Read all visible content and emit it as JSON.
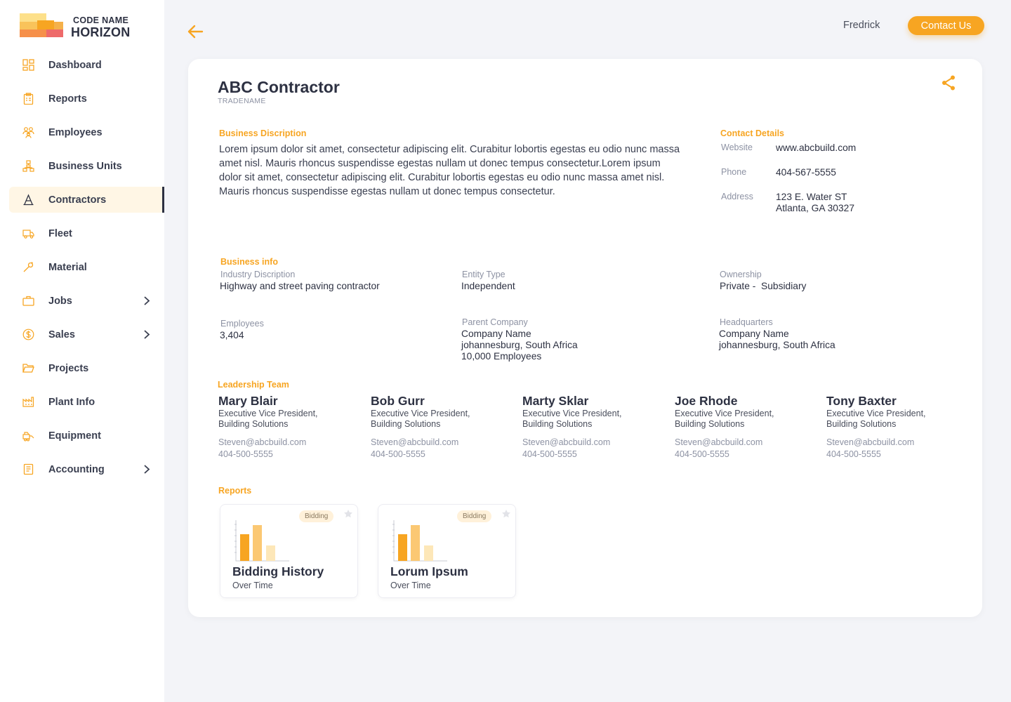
{
  "brand": {
    "line1": "CODE NAME",
    "line2": "HORIZON"
  },
  "sidebar": {
    "items": [
      {
        "label": "Dashboard",
        "icon": "dashboard-icon",
        "active": false,
        "has_submenu": false
      },
      {
        "label": "Reports",
        "icon": "clipboard-icon",
        "active": false,
        "has_submenu": false
      },
      {
        "label": "Employees",
        "icon": "people-icon",
        "active": false,
        "has_submenu": false
      },
      {
        "label": "Business Units",
        "icon": "org-chart-icon",
        "active": false,
        "has_submenu": false
      },
      {
        "label": "Contractors",
        "icon": "contractor-icon",
        "active": true,
        "has_submenu": false
      },
      {
        "label": "Fleet",
        "icon": "truck-icon",
        "active": false,
        "has_submenu": false
      },
      {
        "label": "Material",
        "icon": "wrench-icon",
        "active": false,
        "has_submenu": false
      },
      {
        "label": "Jobs",
        "icon": "briefcase-icon",
        "active": false,
        "has_submenu": true
      },
      {
        "label": "Sales",
        "icon": "dollar-icon",
        "active": false,
        "has_submenu": true
      },
      {
        "label": "Projects",
        "icon": "folder-icon",
        "active": false,
        "has_submenu": false
      },
      {
        "label": "Plant Info",
        "icon": "factory-icon",
        "active": false,
        "has_submenu": false
      },
      {
        "label": "Equipment",
        "icon": "equipment-icon",
        "active": false,
        "has_submenu": false
      },
      {
        "label": "Accounting",
        "icon": "ledger-icon",
        "active": false,
        "has_submenu": true
      }
    ]
  },
  "header": {
    "user_name": "Fredrick",
    "contact_button": "Contact Us"
  },
  "company": {
    "name": "ABC Contractor",
    "tradename_label": "TRADENAME",
    "description_heading": "Business Discription",
    "description": "Lorem ipsum dolor sit amet, consectetur adipiscing elit. Curabitur lobortis egestas eu odio nunc massa amet nisl. Mauris rhoncus suspendisse egestas nullam ut donec tempus consectetur.Lorem ipsum dolor sit amet, consectetur adipiscing elit. Curabitur lobortis egestas eu odio nunc massa amet nisl. Mauris rhoncus suspendisse egestas nullam ut donec tempus consectetur."
  },
  "contact": {
    "heading": "Contact Details",
    "website_label": "Website",
    "website": "www.abcbuild.com",
    "phone_label": "Phone",
    "phone": "404-567-5555",
    "address_label": "Address",
    "address_line1": "123 E. Water ST",
    "address_line2": "Atlanta, GA 30327"
  },
  "business_info": {
    "heading": "Business info",
    "industry_label": "Industry Discription",
    "industry": "Highway and street paving contractor",
    "entity_label": "Entity Type",
    "entity": "Independent",
    "ownership_label": "Ownership",
    "ownership": "Private -  Subsidiary",
    "employees_label": "Employees",
    "employees": "3,404",
    "parent_label": "Parent Company",
    "parent_name": "Company Name",
    "parent_location": "johannesburg, South Africa",
    "parent_employees": "10,000 Employees",
    "hq_label": "Headquarters",
    "hq_name": "Company Name",
    "hq_location": "johannesburg, South Africa"
  },
  "leadership": {
    "heading": "Leadership Team",
    "members": [
      {
        "name": "Mary Blair",
        "role1": "Executive Vice President,",
        "role2": "Building Solutions",
        "email": "Steven@abcbuild.com",
        "phone": "404-500-5555"
      },
      {
        "name": "Bob Gurr",
        "role1": "Executive Vice President,",
        "role2": "Building Solutions",
        "email": "Steven@abcbuild.com",
        "phone": "404-500-5555"
      },
      {
        "name": "Marty Sklar",
        "role1": "Executive Vice President,",
        "role2": "Building Solutions",
        "email": "Steven@abcbuild.com",
        "phone": "404-500-5555"
      },
      {
        "name": "Joe Rhode",
        "role1": "Executive Vice President,",
        "role2": "Building Solutions",
        "email": "Steven@abcbuild.com",
        "phone": "404-500-5555"
      },
      {
        "name": "Tony Baxter",
        "role1": "Executive Vice President,",
        "role2": "Building Solutions",
        "email": "Steven@abcbuild.com",
        "phone": "404-500-5555"
      }
    ]
  },
  "reports": {
    "heading": "Reports",
    "items": [
      {
        "badge": "Bidding",
        "title": "Bidding History",
        "subtitle": "Over Time"
      },
      {
        "badge": "Bidding",
        "title": "Lorum Ipsum",
        "subtitle": "Over Time"
      }
    ]
  },
  "colors": {
    "accent": "#f7a522",
    "text_dark": "#2d3142",
    "text_muted": "#8d92a3",
    "active_bg": "#fff6e5"
  }
}
